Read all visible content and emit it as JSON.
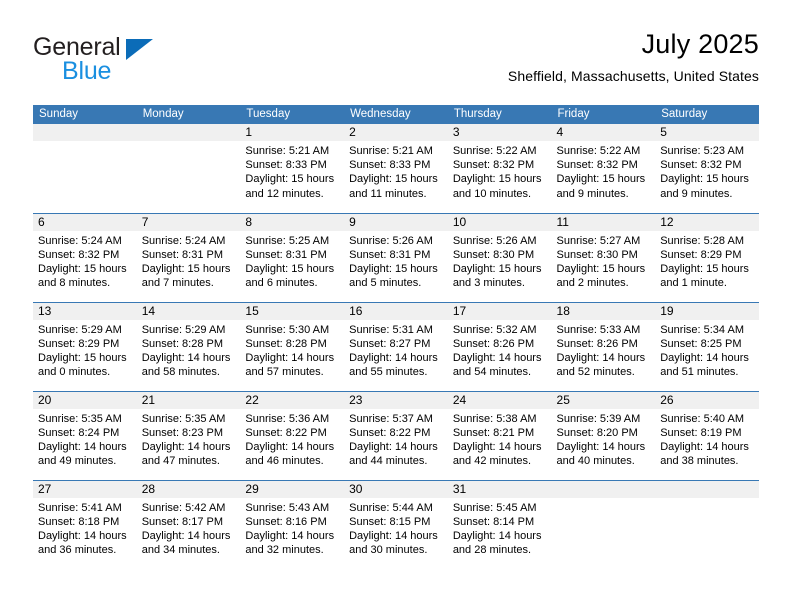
{
  "brand": {
    "name_dark": "General",
    "name_blue": "Blue",
    "color_dark": "#231f20",
    "color_blue": "#1a8fe0",
    "triangle_color": "#0b6cb8"
  },
  "header": {
    "title": "July 2025",
    "subtitle": "Sheffield, Massachusetts, United States"
  },
  "theme": {
    "header_bar": "#3878b4",
    "daynum_band": "#f0f0f0",
    "cell_bg": "#ffffff",
    "text": "#000000"
  },
  "weekdays": [
    "Sunday",
    "Monday",
    "Tuesday",
    "Wednesday",
    "Thursday",
    "Friday",
    "Saturday"
  ],
  "labels": {
    "sunrise_prefix": "Sunrise:",
    "sunset_prefix": "Sunset:",
    "daylight_prefix": "Daylight:"
  },
  "weeks": [
    [
      {
        "day": "",
        "empty": true
      },
      {
        "day": "",
        "empty": true
      },
      {
        "day": "1",
        "sunrise": "Sunrise: 5:21 AM",
        "sunset": "Sunset: 8:33 PM",
        "daylight_1": "Daylight: 15 hours",
        "daylight_2": "and 12 minutes."
      },
      {
        "day": "2",
        "sunrise": "Sunrise: 5:21 AM",
        "sunset": "Sunset: 8:33 PM",
        "daylight_1": "Daylight: 15 hours",
        "daylight_2": "and 11 minutes."
      },
      {
        "day": "3",
        "sunrise": "Sunrise: 5:22 AM",
        "sunset": "Sunset: 8:32 PM",
        "daylight_1": "Daylight: 15 hours",
        "daylight_2": "and 10 minutes."
      },
      {
        "day": "4",
        "sunrise": "Sunrise: 5:22 AM",
        "sunset": "Sunset: 8:32 PM",
        "daylight_1": "Daylight: 15 hours",
        "daylight_2": "and 9 minutes."
      },
      {
        "day": "5",
        "sunrise": "Sunrise: 5:23 AM",
        "sunset": "Sunset: 8:32 PM",
        "daylight_1": "Daylight: 15 hours",
        "daylight_2": "and 9 minutes."
      }
    ],
    [
      {
        "day": "6",
        "sunrise": "Sunrise: 5:24 AM",
        "sunset": "Sunset: 8:32 PM",
        "daylight_1": "Daylight: 15 hours",
        "daylight_2": "and 8 minutes."
      },
      {
        "day": "7",
        "sunrise": "Sunrise: 5:24 AM",
        "sunset": "Sunset: 8:31 PM",
        "daylight_1": "Daylight: 15 hours",
        "daylight_2": "and 7 minutes."
      },
      {
        "day": "8",
        "sunrise": "Sunrise: 5:25 AM",
        "sunset": "Sunset: 8:31 PM",
        "daylight_1": "Daylight: 15 hours",
        "daylight_2": "and 6 minutes."
      },
      {
        "day": "9",
        "sunrise": "Sunrise: 5:26 AM",
        "sunset": "Sunset: 8:31 PM",
        "daylight_1": "Daylight: 15 hours",
        "daylight_2": "and 5 minutes."
      },
      {
        "day": "10",
        "sunrise": "Sunrise: 5:26 AM",
        "sunset": "Sunset: 8:30 PM",
        "daylight_1": "Daylight: 15 hours",
        "daylight_2": "and 3 minutes."
      },
      {
        "day": "11",
        "sunrise": "Sunrise: 5:27 AM",
        "sunset": "Sunset: 8:30 PM",
        "daylight_1": "Daylight: 15 hours",
        "daylight_2": "and 2 minutes."
      },
      {
        "day": "12",
        "sunrise": "Sunrise: 5:28 AM",
        "sunset": "Sunset: 8:29 PM",
        "daylight_1": "Daylight: 15 hours",
        "daylight_2": "and 1 minute."
      }
    ],
    [
      {
        "day": "13",
        "sunrise": "Sunrise: 5:29 AM",
        "sunset": "Sunset: 8:29 PM",
        "daylight_1": "Daylight: 15 hours",
        "daylight_2": "and 0 minutes."
      },
      {
        "day": "14",
        "sunrise": "Sunrise: 5:29 AM",
        "sunset": "Sunset: 8:28 PM",
        "daylight_1": "Daylight: 14 hours",
        "daylight_2": "and 58 minutes."
      },
      {
        "day": "15",
        "sunrise": "Sunrise: 5:30 AM",
        "sunset": "Sunset: 8:28 PM",
        "daylight_1": "Daylight: 14 hours",
        "daylight_2": "and 57 minutes."
      },
      {
        "day": "16",
        "sunrise": "Sunrise: 5:31 AM",
        "sunset": "Sunset: 8:27 PM",
        "daylight_1": "Daylight: 14 hours",
        "daylight_2": "and 55 minutes."
      },
      {
        "day": "17",
        "sunrise": "Sunrise: 5:32 AM",
        "sunset": "Sunset: 8:26 PM",
        "daylight_1": "Daylight: 14 hours",
        "daylight_2": "and 54 minutes."
      },
      {
        "day": "18",
        "sunrise": "Sunrise: 5:33 AM",
        "sunset": "Sunset: 8:26 PM",
        "daylight_1": "Daylight: 14 hours",
        "daylight_2": "and 52 minutes."
      },
      {
        "day": "19",
        "sunrise": "Sunrise: 5:34 AM",
        "sunset": "Sunset: 8:25 PM",
        "daylight_1": "Daylight: 14 hours",
        "daylight_2": "and 51 minutes."
      }
    ],
    [
      {
        "day": "20",
        "sunrise": "Sunrise: 5:35 AM",
        "sunset": "Sunset: 8:24 PM",
        "daylight_1": "Daylight: 14 hours",
        "daylight_2": "and 49 minutes."
      },
      {
        "day": "21",
        "sunrise": "Sunrise: 5:35 AM",
        "sunset": "Sunset: 8:23 PM",
        "daylight_1": "Daylight: 14 hours",
        "daylight_2": "and 47 minutes."
      },
      {
        "day": "22",
        "sunrise": "Sunrise: 5:36 AM",
        "sunset": "Sunset: 8:22 PM",
        "daylight_1": "Daylight: 14 hours",
        "daylight_2": "and 46 minutes."
      },
      {
        "day": "23",
        "sunrise": "Sunrise: 5:37 AM",
        "sunset": "Sunset: 8:22 PM",
        "daylight_1": "Daylight: 14 hours",
        "daylight_2": "and 44 minutes."
      },
      {
        "day": "24",
        "sunrise": "Sunrise: 5:38 AM",
        "sunset": "Sunset: 8:21 PM",
        "daylight_1": "Daylight: 14 hours",
        "daylight_2": "and 42 minutes."
      },
      {
        "day": "25",
        "sunrise": "Sunrise: 5:39 AM",
        "sunset": "Sunset: 8:20 PM",
        "daylight_1": "Daylight: 14 hours",
        "daylight_2": "and 40 minutes."
      },
      {
        "day": "26",
        "sunrise": "Sunrise: 5:40 AM",
        "sunset": "Sunset: 8:19 PM",
        "daylight_1": "Daylight: 14 hours",
        "daylight_2": "and 38 minutes."
      }
    ],
    [
      {
        "day": "27",
        "sunrise": "Sunrise: 5:41 AM",
        "sunset": "Sunset: 8:18 PM",
        "daylight_1": "Daylight: 14 hours",
        "daylight_2": "and 36 minutes."
      },
      {
        "day": "28",
        "sunrise": "Sunrise: 5:42 AM",
        "sunset": "Sunset: 8:17 PM",
        "daylight_1": "Daylight: 14 hours",
        "daylight_2": "and 34 minutes."
      },
      {
        "day": "29",
        "sunrise": "Sunrise: 5:43 AM",
        "sunset": "Sunset: 8:16 PM",
        "daylight_1": "Daylight: 14 hours",
        "daylight_2": "and 32 minutes."
      },
      {
        "day": "30",
        "sunrise": "Sunrise: 5:44 AM",
        "sunset": "Sunset: 8:15 PM",
        "daylight_1": "Daylight: 14 hours",
        "daylight_2": "and 30 minutes."
      },
      {
        "day": "31",
        "sunrise": "Sunrise: 5:45 AM",
        "sunset": "Sunset: 8:14 PM",
        "daylight_1": "Daylight: 14 hours",
        "daylight_2": "and 28 minutes."
      },
      {
        "day": "",
        "empty": true
      },
      {
        "day": "",
        "empty": true
      }
    ]
  ]
}
